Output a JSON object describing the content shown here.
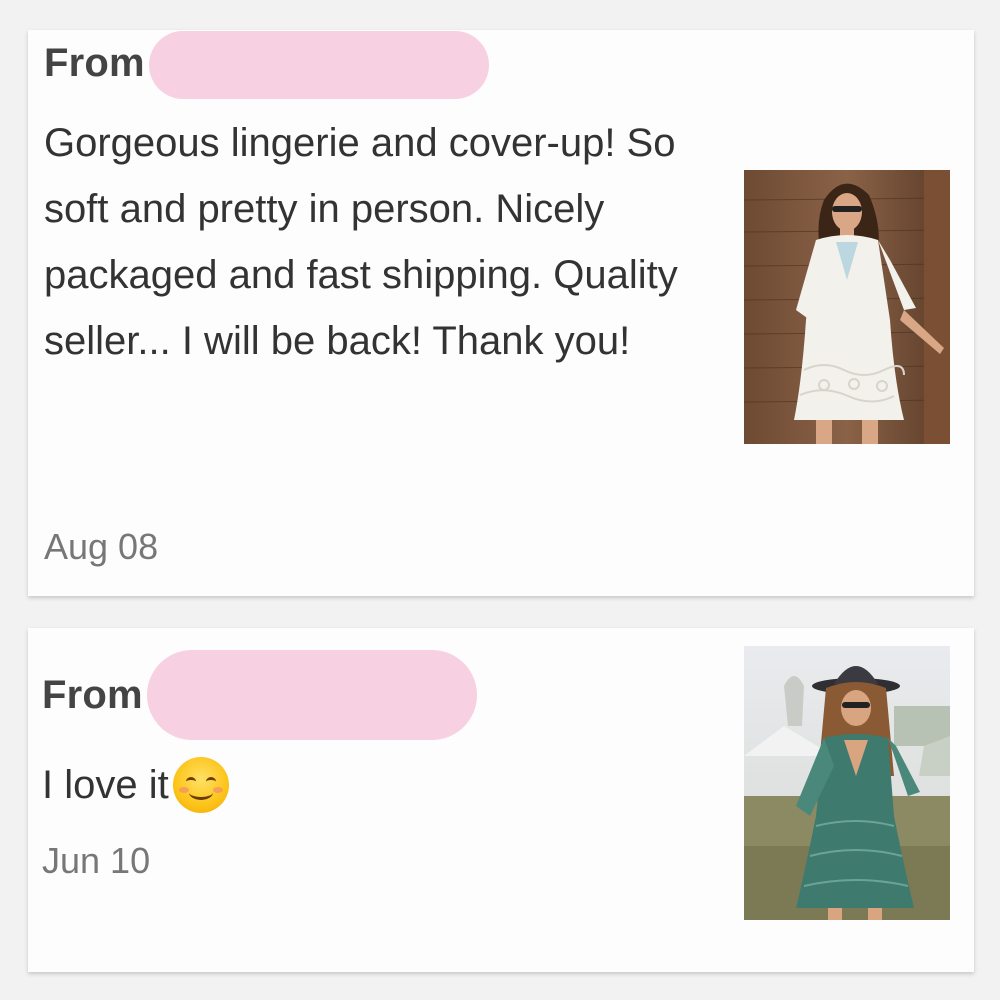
{
  "reviews": [
    {
      "from_label": "From",
      "text": "Gorgeous lingerie and cover-up! So soft and pretty in person. Nicely packaged and fast shipping. Quality seller... I will be back! Thank you!",
      "date": "Aug 08",
      "photo": "product-photo-white-lace-cover-up"
    },
    {
      "from_label": "From",
      "text": "I love it",
      "emoji": "smiling-face-emoji",
      "date": "Jun 10",
      "photo": "product-photo-green-lace-dress"
    }
  ],
  "colors": {
    "redaction": "#f7d0e1",
    "text": "#333333",
    "date": "#777777"
  }
}
